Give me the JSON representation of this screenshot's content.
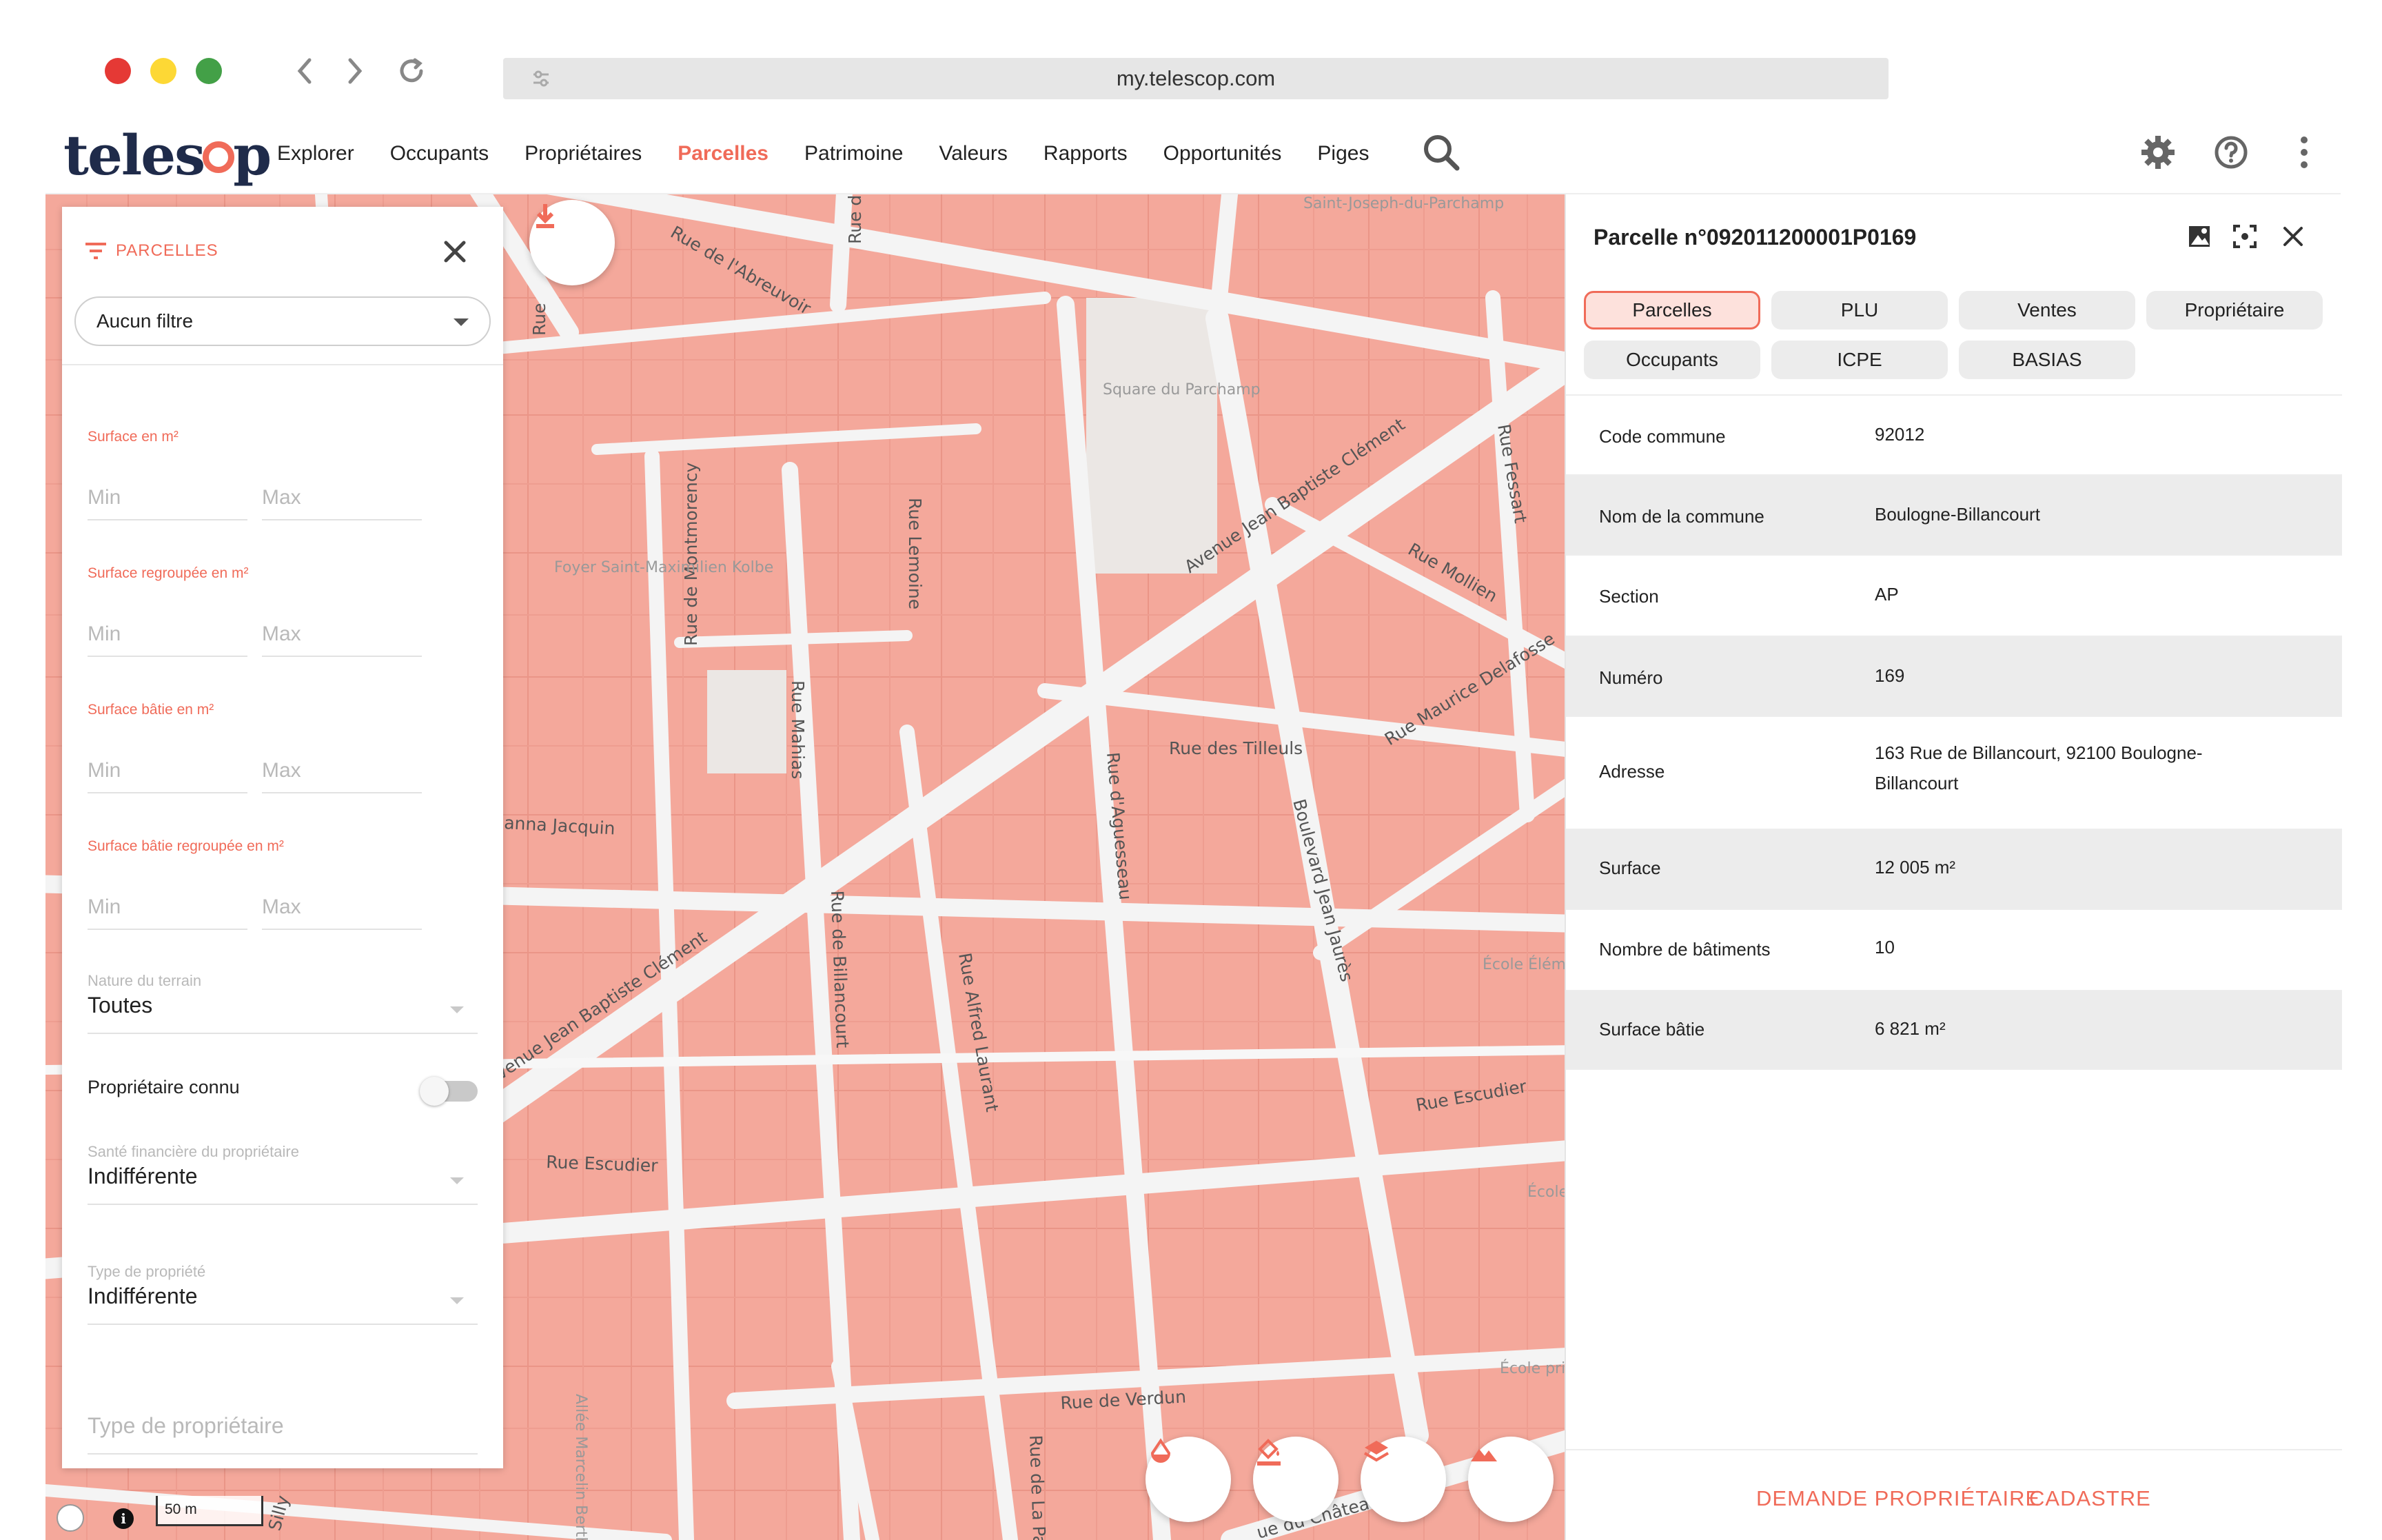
{
  "browser": {
    "url": "my.telescop.com",
    "traffic_lights": [
      "#e53935",
      "#fdd835",
      "#43a047"
    ]
  },
  "app": {
    "logo": "telescop",
    "menu": [
      {
        "label": "Explorer",
        "active": false
      },
      {
        "label": "Occupants",
        "active": false
      },
      {
        "label": "Propriétaires",
        "active": false
      },
      {
        "label": "Parcelles",
        "active": true
      },
      {
        "label": "Patrimoine",
        "active": false
      },
      {
        "label": "Valeurs",
        "active": false
      },
      {
        "label": "Rapports",
        "active": false
      },
      {
        "label": "Opportunités",
        "active": false
      },
      {
        "label": "Piges",
        "active": false
      }
    ],
    "accent_color": "#f06b59"
  },
  "filter_panel": {
    "title": "PARCELLES",
    "filter_select": "Aucun filtre",
    "fields": [
      {
        "label": "Surface en m²",
        "min": "Min",
        "max": "Max"
      },
      {
        "label": "Surface regroupée en m²",
        "min": "Min",
        "max": "Max"
      },
      {
        "label": "Surface bâtie en m²",
        "min": "Min",
        "max": "Max"
      },
      {
        "label": "Surface bâtie regroupée en m²",
        "min": "Min",
        "max": "Max"
      }
    ],
    "nature_label": "Nature du terrain",
    "nature_value": "Toutes",
    "owner_known_label": "Propriétaire connu",
    "owner_known": false,
    "health_label": "Santé financière du propriétaire",
    "health_value": "Indifférente",
    "type_label": "Type de propriété",
    "type_value": "Indifférente",
    "type_placeholder": "Type de propriétaire"
  },
  "map": {
    "parcel_color": "#f4a89b",
    "street_labels": [
      "Rue de l'Abreuvoir",
      "Avenue Jean Baptiste Clément",
      "Rue Lemoine",
      "Rue de Montmorency",
      "Rue Mahias",
      "Rue Fessart",
      "Rue Mollien",
      "Rue Maurice Delafosse",
      "Rue des Tilleuls",
      "Rue d'Aguesseau",
      "Boulevard Jean Jaurès",
      "Rue de Billancourt",
      "Rue Alfred Laurant",
      "Rue Escudier",
      "Rue Escudier",
      "Rue de Verdun",
      "Rue de La Paix",
      "anna Jacquin",
      "venue Jean Baptiste Clément",
      "Rue",
      "Rue d",
      "Silly",
      "ue du Château"
    ],
    "poi_labels": [
      "Square du Parchamp",
      "Foyer Saint-Maximilien Kolbe",
      "Saint-Joseph-du-Parchamp",
      "École Élém. Escudi",
      "École m. Fe",
      "École pri. privée S. Alexan",
      "Allée Marcelin Berthelot"
    ],
    "scale_label": "50 m"
  },
  "detail": {
    "title": "Parcelle n°092011200001P0169",
    "tabs": [
      {
        "label": "Parcelles",
        "active": true
      },
      {
        "label": "PLU",
        "active": false
      },
      {
        "label": "Ventes",
        "active": false
      },
      {
        "label": "Propriétaire",
        "active": false
      },
      {
        "label": "Occupants",
        "active": false
      },
      {
        "label": "ICPE",
        "active": false
      },
      {
        "label": "BASIAS",
        "active": false
      }
    ],
    "rows": [
      {
        "key": "Code commune",
        "value": "92012"
      },
      {
        "key": "Nom de la commune",
        "value": "Boulogne-Billancourt"
      },
      {
        "key": "Section",
        "value": "AP"
      },
      {
        "key": "Numéro",
        "value": "169"
      },
      {
        "key": "Adresse",
        "value": "163 Rue de Billancourt, 92100 Boulogne-Billancourt"
      },
      {
        "key": "Surface",
        "value": "12 005 m²"
      },
      {
        "key": "Nombre de bâtiments",
        "value": "10"
      },
      {
        "key": "Surface bâtie",
        "value": "6 821 m²"
      }
    ],
    "links": [
      "DEMANDE PROPRIÉTAIRE",
      "CADASTRE"
    ]
  }
}
